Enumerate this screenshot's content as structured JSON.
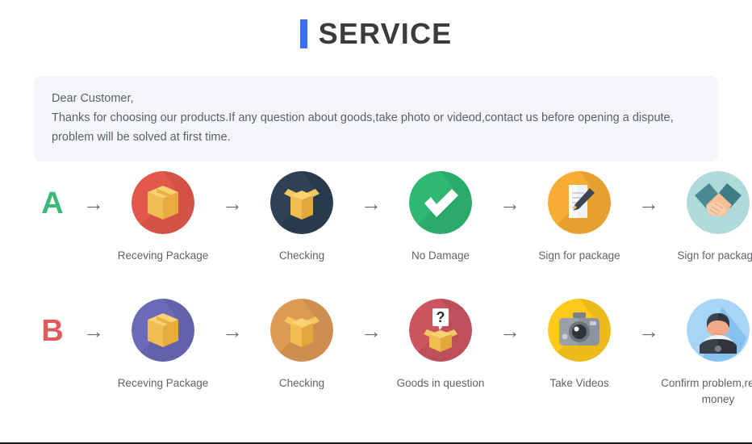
{
  "header": {
    "title": "SERVICE",
    "accent_color": "#3b6ef5",
    "title_color": "#3b3b3b"
  },
  "notice": {
    "line1": "Dear Customer,",
    "line2": "Thanks for choosing our products.If any question about goods,take photo or videod,contact us before opening a dispute,",
    "line3": "problem will be solved at first time.",
    "background": "#f5f6fa",
    "text_color": "#5a5f66"
  },
  "flows": [
    {
      "letter": "A",
      "letter_color": "#3cb878",
      "steps": [
        {
          "label": "Receving Package",
          "icon": "closed-box-icon",
          "circle_color": "#e2594c"
        },
        {
          "label": "Checking",
          "icon": "open-box-icon",
          "circle_color": "#2e4156"
        },
        {
          "label": "No Damage",
          "icon": "check-mark-icon",
          "circle_color": "#2eb872"
        },
        {
          "label": "Sign for package",
          "icon": "document-pen-icon",
          "circle_color": "#f7ad33"
        },
        {
          "label": "Sign for package",
          "icon": "handshake-icon",
          "circle_color": "#aedad9"
        }
      ]
    },
    {
      "letter": "B",
      "letter_color": "#e05b5b",
      "steps": [
        {
          "label": "Receving Package",
          "icon": "closed-box-icon",
          "circle_color": "#6b6ab8"
        },
        {
          "label": "Checking",
          "icon": "open-box-icon",
          "circle_color": "#dd9a55"
        },
        {
          "label": "Goods in question",
          "icon": "question-box-icon",
          "circle_color": "#cc5560"
        },
        {
          "label": "Take Videos",
          "icon": "camera-icon",
          "circle_color": "#ffc91e"
        },
        {
          "label": "Confirm problem,refund money",
          "icon": "support-agent-icon",
          "circle_color": "#a8d5f5"
        }
      ]
    }
  ],
  "arrow_glyph": "→"
}
